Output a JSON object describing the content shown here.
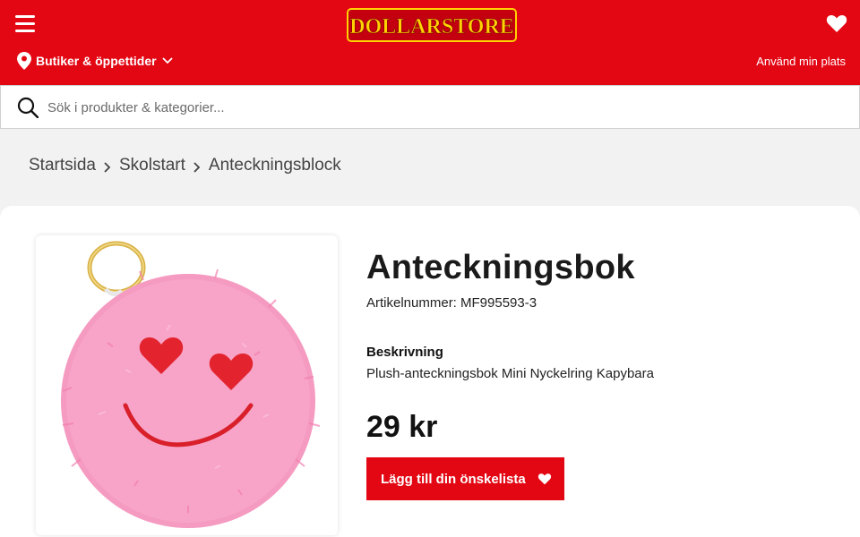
{
  "header": {
    "logo_text": "DOLLARSTORE",
    "stores_label": "Butiker & öppettider",
    "use_location_label": "Använd min plats",
    "icons": {
      "menu": "hamburger-icon",
      "wishlist": "heart-icon",
      "location": "map-pin-icon",
      "dropdown": "chevron-down-icon"
    }
  },
  "search": {
    "placeholder": "Sök i produkter & kategorier...",
    "value": "",
    "icon": "search-icon"
  },
  "breadcrumb": {
    "items": [
      "Startsida",
      "Skolstart",
      "Anteckningsblock"
    ]
  },
  "product": {
    "title": "Anteckningsbok",
    "article_number": "Artikelnummer: MF995593-3",
    "description_heading": "Beskrivning",
    "description": "Plush-anteckningsbok Mini Nyckelring Kapybara",
    "price": "29 kr",
    "wishlist_button": "Lägg till din önskelista"
  },
  "colors": {
    "brand_red": "#e30613",
    "logo_yellow": "#ffd200",
    "plush_pink": "#f59ac0"
  }
}
